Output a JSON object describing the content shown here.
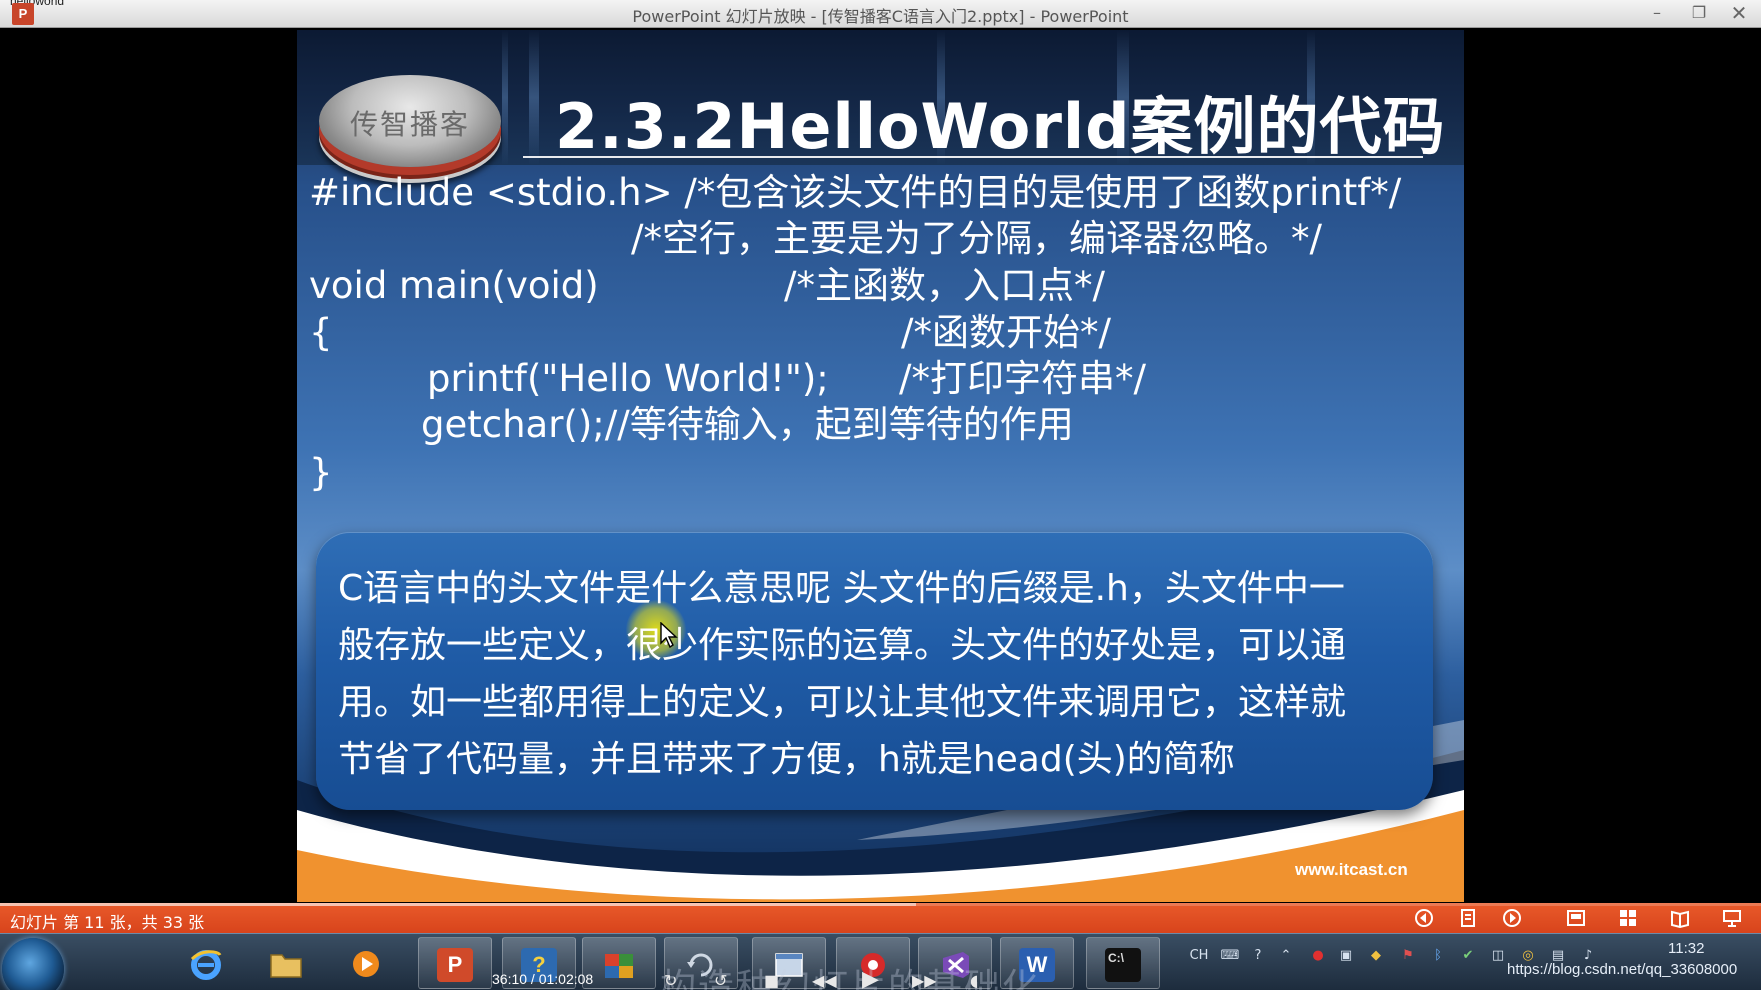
{
  "window": {
    "doc_tab": "helloworld",
    "app_icon_letter": "P",
    "title": "PowerPoint 幻灯片放映 - [传智播客C语言入门2.pptx] - PowerPoint",
    "minimize_glyph": "–",
    "restore_glyph": "❐",
    "close_glyph": "✕"
  },
  "slide": {
    "logo_text": "传智播客",
    "title": "2.3.2HelloWorld案例的代码",
    "code_lines": [
      "#include <stdio.h> /*包含该头文件的目的是使用了函数printf*/",
      "/*空行，主要是为了分隔，编译器忽略。*/",
      "void main(void)",
      "/*主函数，入口点*/",
      "{",
      "/*函数开始*/",
      "printf(\"Hello World!\");",
      "/*打印字符串*/",
      "getchar();//等待输入，起到等待的作用",
      "}"
    ],
    "callout_lines": [
      "C语言中的头文件是什么意思呢 头文件的后缀是.h，头文件中一",
      "般存放一些定义，很少作实际的运算。头文件的好处是，可以通",
      "用。如一些都用得上的定义，可以让其他文件来调用它，这样就",
      "节省了代码量，并且带来了方便，h就是head(头)的简称"
    ],
    "website": "www.itcast.cn"
  },
  "statusbar": {
    "slide_counter": "幻灯片 第 11 张，共 33 张",
    "progress_fraction": 0.52
  },
  "taskbar": {
    "powerpoint_letter": "P",
    "help_glyph": "?",
    "word_letter": "W",
    "cmd_text": "C:\\",
    "player_time": "36:10 / 01:02:08",
    "overlay_caption": "构造种幻灯片的基础化",
    "tray_lang": "CH",
    "clock": "11:32",
    "watermark": "https://blog.csdn.net/qq_33608000"
  },
  "colors": {
    "statusbar": "#e0501f",
    "slide_blue": "#3e73b4",
    "bubble_blue": "#1f5ba6",
    "accent_orange": "#f0922f"
  }
}
